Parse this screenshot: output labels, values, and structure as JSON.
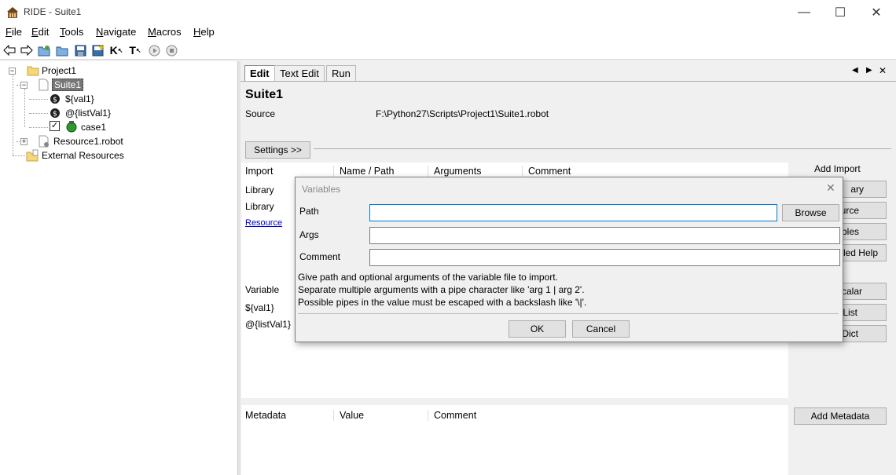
{
  "window": {
    "title": "RIDE - Suite1",
    "minimize": "—",
    "maximize": "☐",
    "close": "✕"
  },
  "menu": {
    "items": [
      {
        "first": "F",
        "rest": "ile"
      },
      {
        "first": "E",
        "rest": "dit"
      },
      {
        "first": "T",
        "rest": "ools"
      },
      {
        "first": "N",
        "rest": "avigate"
      },
      {
        "first": "M",
        "rest": "acros"
      },
      {
        "first": "H",
        "rest": "elp"
      }
    ]
  },
  "toolbar": {
    "k_label": "K",
    "t_label": "T"
  },
  "tree": {
    "project": "Project1",
    "suite": "Suite1",
    "var1": "${val1}",
    "var2": "@{listVal1}",
    "testcase": "case1",
    "resource": "Resource1.robot",
    "external": "External Resources"
  },
  "tabs": {
    "edit": "Edit",
    "text_edit": "Text Edit",
    "run": "Run"
  },
  "editor": {
    "suite_title": "Suite1",
    "source_label": "Source",
    "source_path": "F:\\Python27\\Scripts\\Project1\\Suite1.robot",
    "settings_button": "Settings >>",
    "import_headers": [
      "Import",
      "Name / Path",
      "Arguments",
      "Comment"
    ],
    "import_rows": [
      "Library",
      "Library"
    ],
    "resource_link": "Resource",
    "variable_header": "Variable",
    "variable_rows": [
      "${val1}",
      "@{listVal1}"
    ],
    "metadata_headers": [
      "Metadata",
      "Value",
      "Comment"
    ]
  },
  "side_buttons": {
    "add_import_label": "Add Import",
    "library_partial": "ary",
    "resource_partial": "urce",
    "variables_partial": "bles",
    "help_partial": "iled Help",
    "scalar_partial": "calar",
    "list_partial": "List",
    "dict_partial": "Dict",
    "add_metadata": "Add Metadata"
  },
  "dialog": {
    "title": "Variables",
    "close": "✕",
    "path_label": "Path",
    "path_value": "",
    "browse": "Browse",
    "args_label": "Args",
    "args_value": "",
    "comment_label": "Comment",
    "comment_value": "",
    "help1": "Give path and optional arguments of the variable file to import.",
    "help2": "Separate multiple arguments with a pipe character like 'arg 1 | arg 2'.",
    "help3": "Possible pipes in the value must be escaped with a backslash like '\\|'.",
    "ok": "OK",
    "cancel": "Cancel"
  },
  "colors": {
    "accent": "#0078d7",
    "selection": "#cce8ff",
    "link": "#0000cc"
  }
}
